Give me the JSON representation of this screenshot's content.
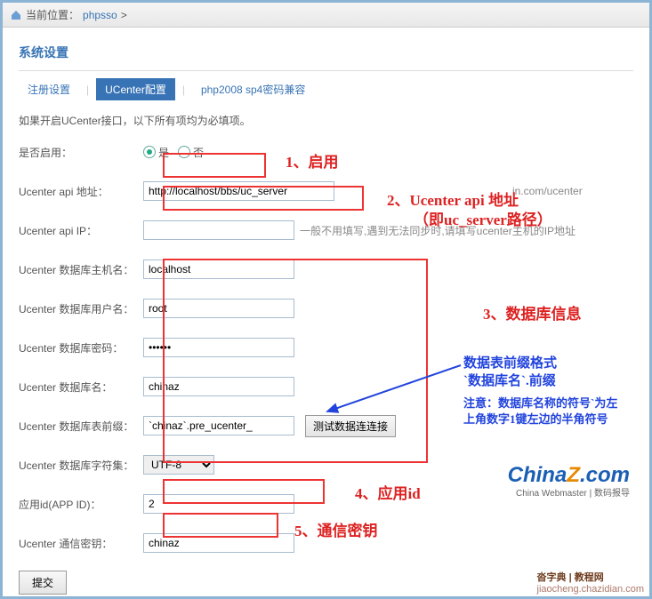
{
  "location": {
    "prefix": "当前位置：",
    "crumb": "phpsso",
    "sep": ">"
  },
  "title": "系统设置",
  "tabs": [
    {
      "label": "注册设置",
      "active": false
    },
    {
      "label": "UCenter配置",
      "active": true
    },
    {
      "label": "php2008 sp4密码兼容",
      "active": false
    }
  ],
  "hint": "如果开启UCenter接口，以下所有项均为必填项。",
  "rows": {
    "enable": {
      "label": "是否启用：",
      "yes": "是",
      "no": "否"
    },
    "api": {
      "label": "Ucenter api 地址：",
      "value": "http://localhost/bbs/uc_server",
      "help": "in.com/ucenter"
    },
    "ip": {
      "label": "Ucenter api IP：",
      "value": "",
      "help": "一般不用填写,遇到无法同步时,请填写ucenter主机的IP地址"
    },
    "dbhost": {
      "label": "Ucenter 数据库主机名：",
      "value": "localhost"
    },
    "dbuser": {
      "label": "Ucenter 数据库用户名：",
      "value": "root"
    },
    "dbpass": {
      "label": "Ucenter 数据库密码：",
      "value": "••••••"
    },
    "dbname": {
      "label": "Ucenter 数据库名：",
      "value": "chinaz"
    },
    "dbprefix": {
      "label": "Ucenter 数据库表前缀：",
      "value": "`chinaz`.pre_ucenter_",
      "test": "测试数据连连接"
    },
    "dbcharset": {
      "label": "Ucenter 数据库字符集：",
      "value": "UTF-8"
    },
    "appid": {
      "label": "应用id(APP ID)：",
      "value": "2"
    },
    "commkey": {
      "label": "Ucenter 通信密钥：",
      "value": "chinaz"
    }
  },
  "submit": "提交",
  "annotations": {
    "a1": "1、启用",
    "a2l1": "2、Ucenter api 地址",
    "a2l2": "（即uc_server路径）",
    "a3": "3、数据库信息",
    "a4": "4、应用id",
    "a5": "5、通信密钥",
    "b1": "数据表前缀格式",
    "b2": "`数据库名`.前缀",
    "b3": "注意：数据库名称的符号`为左上角数字1键左边的半角符号"
  },
  "logo": {
    "c": "China",
    "z": "Z",
    "dot": ".com",
    "sub": "China Webmaster | 数码报导"
  },
  "footer": {
    "a": "沓字典 | ",
    "b": "教程网",
    "c": "jiaocheng.chazidian.com"
  }
}
